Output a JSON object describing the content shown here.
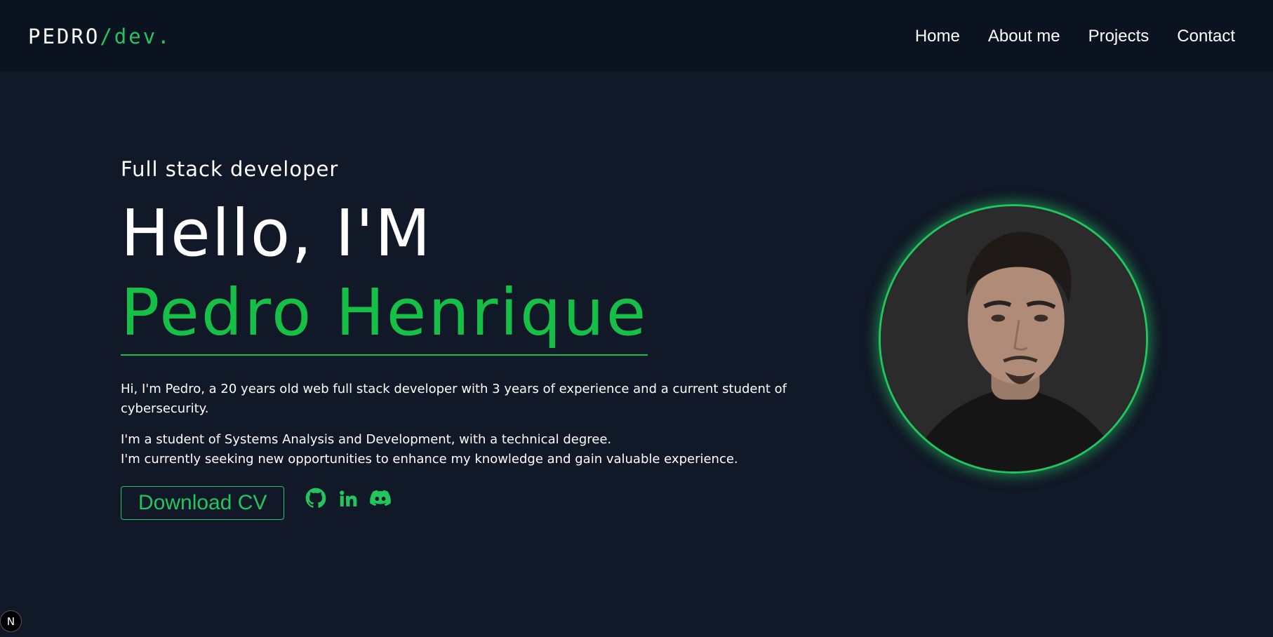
{
  "header": {
    "logo_main": "PEDRO",
    "logo_accent": "/dev.",
    "nav": [
      {
        "label": "Home"
      },
      {
        "label": "About me"
      },
      {
        "label": "Projects"
      },
      {
        "label": "Contact"
      }
    ]
  },
  "hero": {
    "subtitle": "Full stack developer",
    "greeting": "Hello, I'M",
    "name": "Pedro Henrique",
    "bio_line1": "Hi, I'm Pedro, a 20 years old web full stack developer with 3 years of experience and a current student of cybersecurity.",
    "bio_line2": "I'm a student of Systems Analysis and Development, with a technical degree.",
    "bio_line3": "I'm currently seeking new opportunities to enhance my knowledge and gain valuable experience.",
    "cv_button": "Download CV",
    "socials": [
      "github-icon",
      "linkedin-icon",
      "discord-icon"
    ]
  },
  "badge": {
    "label": "N"
  },
  "colors": {
    "accent": "#22c55e",
    "background": "#111827",
    "navbar": "#0b1220"
  }
}
